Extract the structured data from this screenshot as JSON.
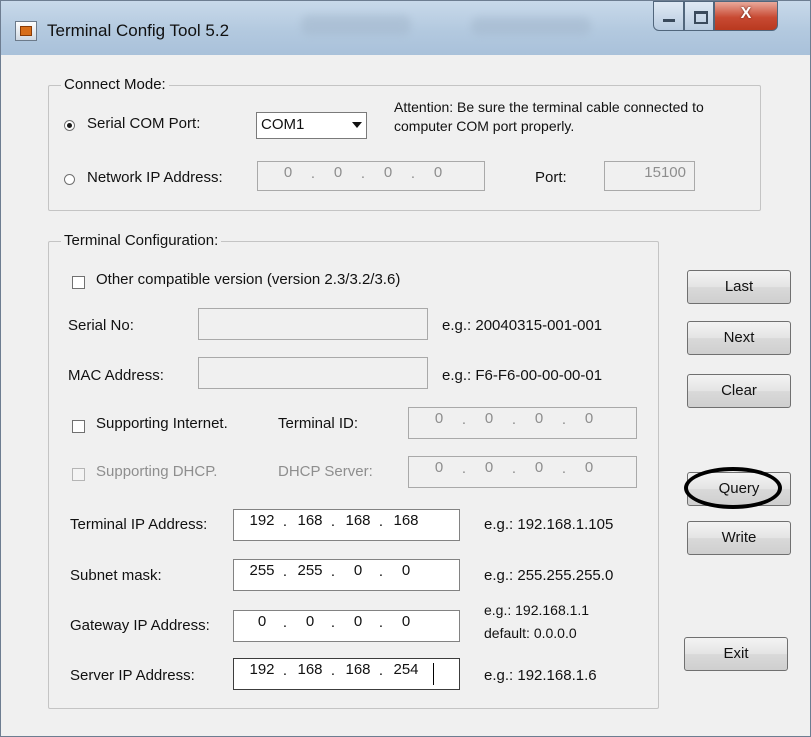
{
  "window": {
    "title": "Terminal Config Tool 5.2",
    "close_glyph": "X"
  },
  "connect_mode": {
    "legend": "Connect Mode:",
    "serial_label": "Serial COM Port:",
    "serial_selected": true,
    "com_value": "COM1",
    "attention_line1": "Attention: Be sure the terminal cable connected to",
    "attention_line2": "computer COM port properly.",
    "network_label": "Network IP Address:",
    "network_ip": [
      "0",
      "0",
      "0",
      "0"
    ],
    "port_label": "Port:",
    "port_value": "15100"
  },
  "terminal_config": {
    "legend": "Terminal Configuration:",
    "other_version_label": "Other compatible version (version 2.3/3.2/3.6)",
    "serial_no_label": "Serial No:",
    "serial_no_example": "e.g.: 20040315-001-001",
    "mac_label": "MAC Address:",
    "mac_example": "e.g.: F6-F6-00-00-00-01",
    "supporting_internet_label": "Supporting Internet.",
    "terminal_id_label": "Terminal ID:",
    "terminal_id": [
      "0",
      "0",
      "0",
      "0"
    ],
    "supporting_dhcp_label": "Supporting DHCP.",
    "dhcp_server_label": "DHCP Server:",
    "dhcp_server": [
      "0",
      "0",
      "0",
      "0"
    ],
    "terminal_ip_label": "Terminal IP Address:",
    "terminal_ip": [
      "192",
      "168",
      "168",
      "168"
    ],
    "terminal_ip_example": "e.g.: 192.168.1.105",
    "subnet_label": "Subnet mask:",
    "subnet": [
      "255",
      "255",
      "0",
      "0"
    ],
    "subnet_example": "e.g.: 255.255.255.0",
    "gateway_label": "Gateway IP Address:",
    "gateway": [
      "0",
      "0",
      "0",
      "0"
    ],
    "gateway_example_line1": "e.g.: 192.168.1.1",
    "gateway_example_line2": "default: 0.0.0.0",
    "server_label": "Server IP Address:",
    "server": [
      "192",
      "168",
      "168",
      "254"
    ],
    "server_example": "e.g.: 192.168.1.6"
  },
  "buttons": {
    "last": "Last",
    "next": "Next",
    "clear": "Clear",
    "query": "Query",
    "write": "Write",
    "exit": "Exit"
  }
}
